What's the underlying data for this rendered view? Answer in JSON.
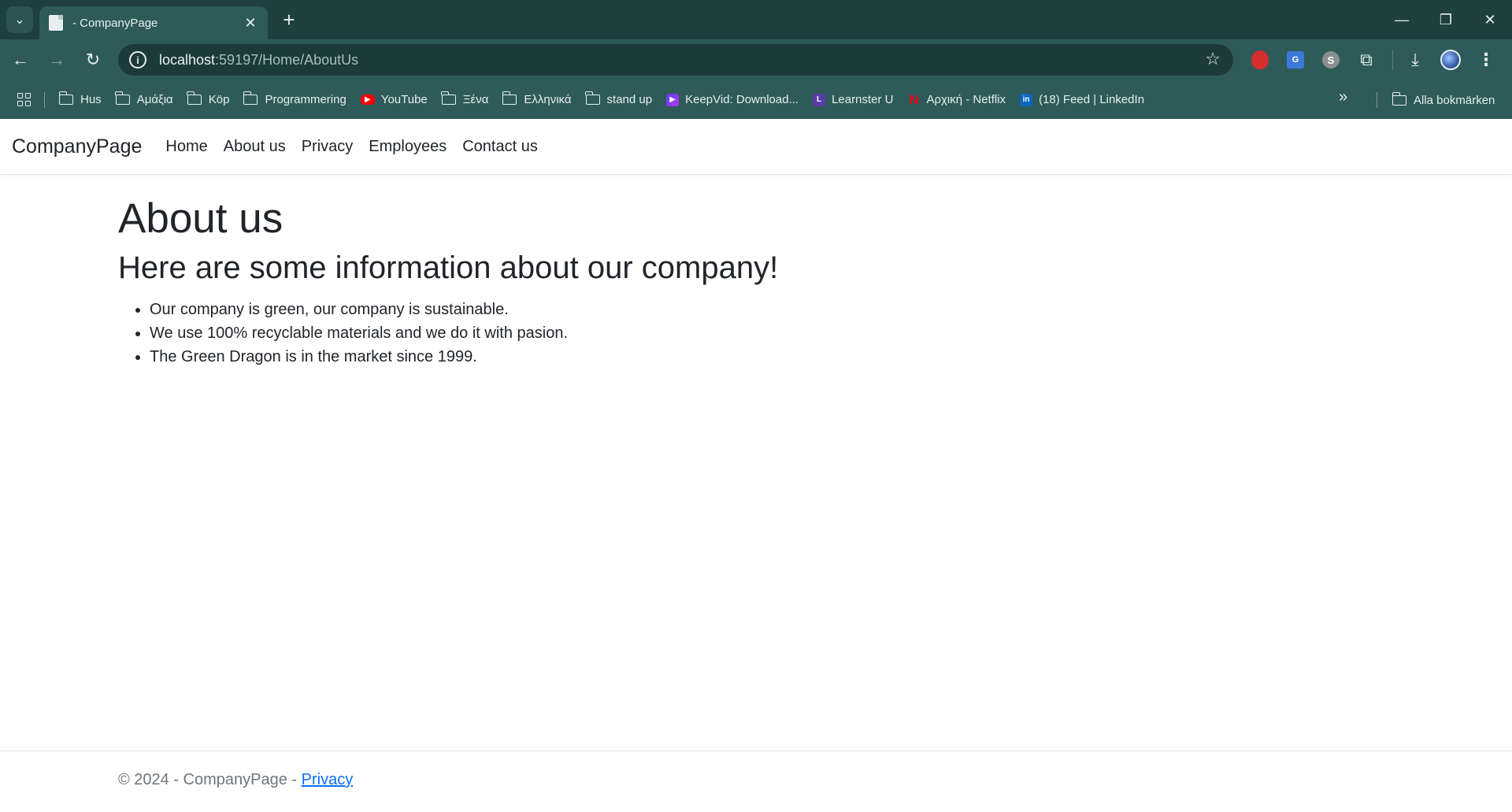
{
  "browser": {
    "tab_title": "- CompanyPage",
    "url_host": "localhost",
    "url_path": ":59197/Home/AboutUs",
    "bookmarks": [
      {
        "label": "Hus",
        "icon": "folder-icon"
      },
      {
        "label": "Αμάξια",
        "icon": "folder-icon"
      },
      {
        "label": "Köp",
        "icon": "folder-icon"
      },
      {
        "label": "Programmering",
        "icon": "folder-icon"
      },
      {
        "label": "YouTube",
        "icon": "youtube-icon"
      },
      {
        "label": "Ξένα",
        "icon": "folder-icon"
      },
      {
        "label": "Ελληνικά",
        "icon": "folder-icon"
      },
      {
        "label": "stand up",
        "icon": "folder-icon"
      },
      {
        "label": "KeepVid: Download...",
        "icon": "keepvid-icon"
      },
      {
        "label": "Learnster U",
        "icon": "learnster-icon"
      },
      {
        "label": "Αρχική - Netflix",
        "icon": "netflix-icon"
      },
      {
        "label": "(18) Feed | LinkedIn",
        "icon": "linkedin-icon"
      }
    ],
    "all_bookmarks": "Alla bokmärken"
  },
  "site": {
    "brand": "CompanyPage",
    "nav": [
      "Home",
      "About us",
      "Privacy",
      "Employees",
      "Contact us"
    ]
  },
  "main": {
    "title": "About us",
    "subtitle": "Here are some information about our company!",
    "facts": [
      "Our company is green, our company is sustainable.",
      "We use 100% recyclable materials and we do it with pasion.",
      "The Green Dragon is in the market since 1999."
    ]
  },
  "footer": {
    "text": "© 2024 - CompanyPage - ",
    "link": "Privacy"
  }
}
